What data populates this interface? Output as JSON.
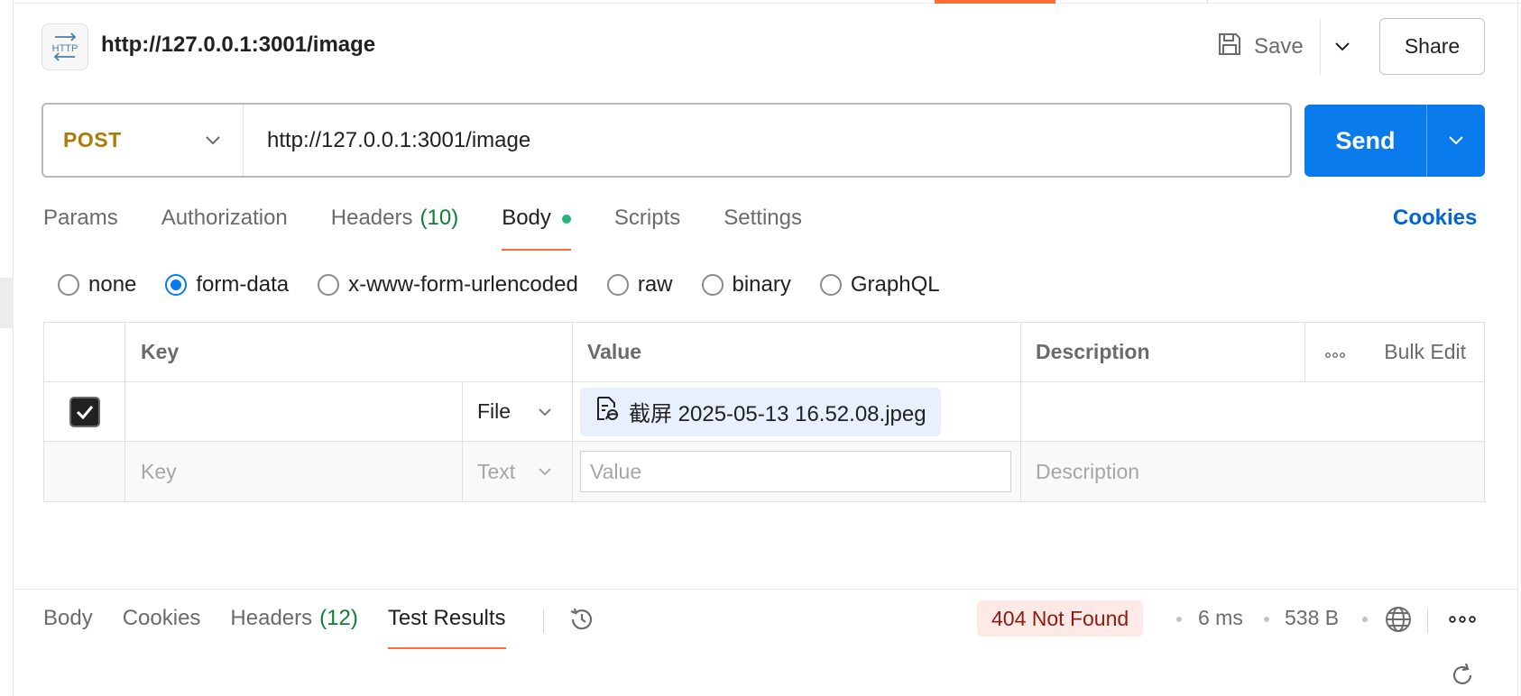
{
  "request": {
    "title": "http://127.0.0.1:3001/image",
    "icon": "http-icon",
    "save_label": "Save",
    "share_label": "Share"
  },
  "url_bar": {
    "method": "POST",
    "url": "http://127.0.0.1:3001/image",
    "send_label": "Send"
  },
  "request_tabs": [
    {
      "label": "Params",
      "count": ""
    },
    {
      "label": "Authorization",
      "count": ""
    },
    {
      "label": "Headers",
      "count": "(10)"
    },
    {
      "label": "Body",
      "count": "",
      "active": true
    },
    {
      "label": "Scripts",
      "count": ""
    },
    {
      "label": "Settings",
      "count": ""
    }
  ],
  "cookies_link": "Cookies",
  "body_types": [
    {
      "label": "none",
      "checked": false
    },
    {
      "label": "form-data",
      "checked": true
    },
    {
      "label": "x-www-form-urlencoded",
      "checked": false
    },
    {
      "label": "raw",
      "checked": false
    },
    {
      "label": "binary",
      "checked": false
    },
    {
      "label": "GraphQL",
      "checked": false
    }
  ],
  "table": {
    "headers": {
      "key": "Key",
      "value": "Value",
      "description": "Description",
      "bulk_edit": "Bulk Edit"
    },
    "rows": [
      {
        "checked": true,
        "key": "",
        "type": "File",
        "value": "截屏 2025-05-13 16.52.08.jpeg",
        "description": ""
      }
    ],
    "placeholder_row": {
      "key": "Key",
      "type": "Text",
      "value": "Value",
      "description": "Description"
    }
  },
  "response": {
    "tabs": [
      {
        "label": "Body",
        "count": ""
      },
      {
        "label": "Cookies",
        "count": ""
      },
      {
        "label": "Headers",
        "count": "(12)"
      },
      {
        "label": "Test Results",
        "count": "",
        "active": true
      }
    ],
    "status": "404 Not Found",
    "time": "6 ms",
    "size": "538 B"
  },
  "colors": {
    "accent": "#ff6c37",
    "send": "#097bed",
    "method": "#ad7a03",
    "status_bg": "#fde9e6",
    "status_text": "#8e1a10",
    "count_green": "#0f7d33"
  }
}
